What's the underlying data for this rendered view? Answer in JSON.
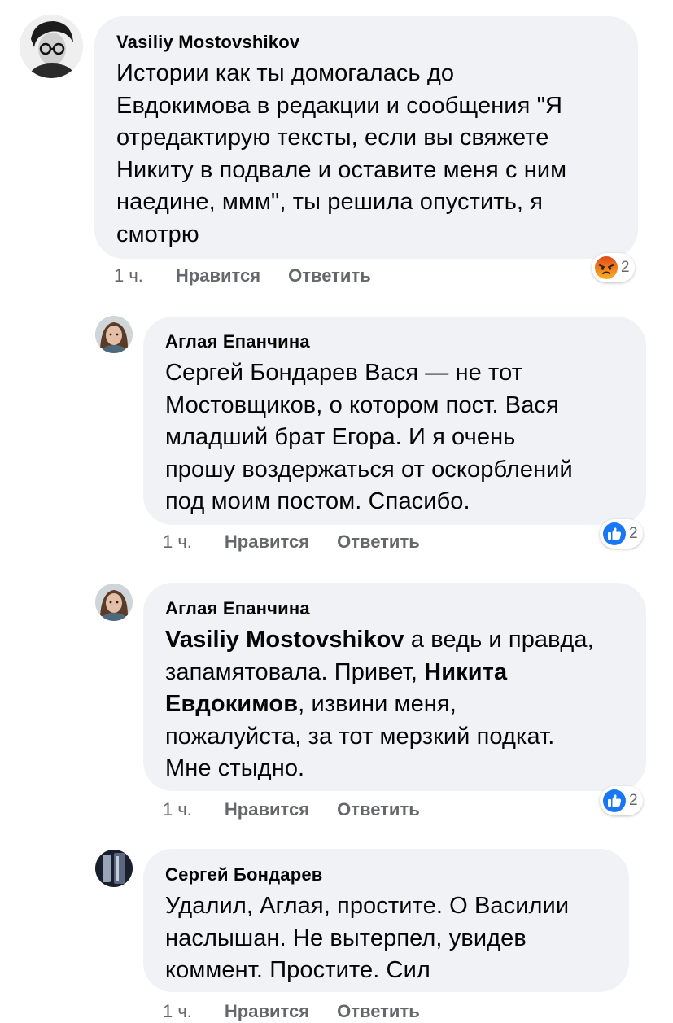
{
  "comments": [
    {
      "author": "Vasiliy Mostovshikov",
      "lines": [
        "Истории как ты домогалась до",
        "Евдокимова в редакции и сообщения \"Я",
        "отредактирую тексты, если вы свяжете",
        "Никиту в подвале и оставите меня с ним",
        "наедине, ммм\", ты решила опустить, я",
        "смотрю"
      ],
      "time": "1 ч.",
      "like": "Нравится",
      "reply": "Ответить",
      "reaction_icon": "angry-icon",
      "reaction_count": "2"
    },
    {
      "author": "Аглая Епанчина",
      "lines": [
        "Сергей Бондарев Вася — не тот",
        "Мостовщиков, о котором пост. Вася",
        "младший брат Егора. И я очень",
        "прошу воздержаться от оскорблений",
        "под моим постом. Спасибо."
      ],
      "time": "1 ч.",
      "like": "Нравится",
      "reply": "Ответить",
      "reaction_icon": "like-icon",
      "reaction_count": "2"
    },
    {
      "author": "Аглая Епанчина",
      "mention1": "Vasiliy Mostovshikov",
      "line1_rest": " а ведь и правда,",
      "line2": "запамятовала. Привет, ",
      "mention2a": "Никита",
      "mention2b": "Евдокимов",
      "line3_rest": ", извини меня,",
      "line4": "пожалуйста, за тот мерзкий подкат.",
      "line5": "Мне стыдно.",
      "time": "1 ч.",
      "like": "Нравится",
      "reply": "Ответить",
      "reaction_icon": "like-icon",
      "reaction_count": "2"
    },
    {
      "author": "Сергей Бондарев",
      "lines": [
        "Удалил, Аглая, простите. О Василии",
        "наслышан. Не вытерпел, увидев",
        "коммент. Простите. Сил"
      ],
      "time": "1 ч.",
      "like": "Нравится",
      "reply": "Ответить"
    }
  ],
  "colors": {
    "bubble": "#f0f2f5",
    "meta": "#65676b",
    "like_blue": "#1877f2",
    "angry": "#e9710f"
  }
}
